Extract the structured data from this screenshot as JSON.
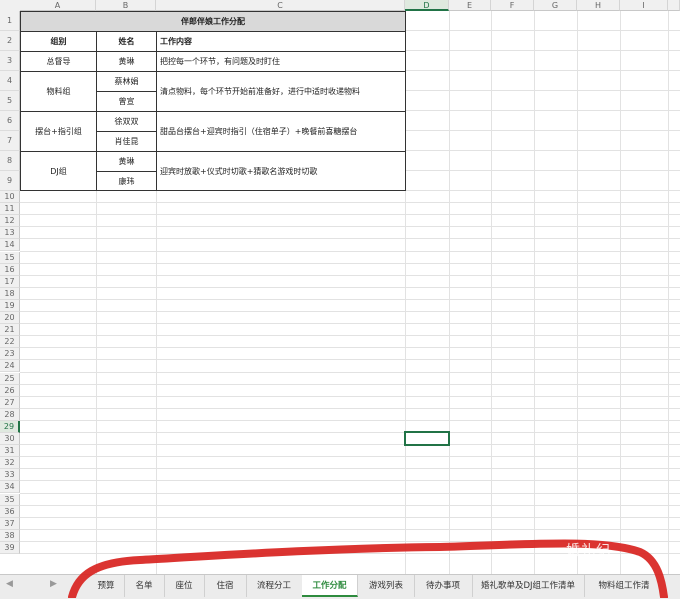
{
  "columns": [
    "A",
    "B",
    "C",
    "D",
    "E",
    "F",
    "G",
    "H",
    "I"
  ],
  "selected_column": "D",
  "rows": [
    "1",
    "2",
    "3",
    "4",
    "5",
    "6",
    "7",
    "8",
    "9",
    "10",
    "11",
    "12",
    "13",
    "14",
    "15",
    "16",
    "17",
    "18",
    "19",
    "20",
    "21",
    "22",
    "23",
    "24",
    "25",
    "26",
    "27",
    "28",
    "29",
    "30",
    "31",
    "32",
    "33",
    "34",
    "35",
    "36",
    "37",
    "38",
    "39"
  ],
  "selected_row": "29",
  "table": {
    "title": "伴郎伴娘工作分配",
    "headers": {
      "group": "组别",
      "name": "姓名",
      "content": "工作内容"
    },
    "groups": [
      {
        "group": "总督导",
        "names": [
          "黄琳"
        ],
        "content": "把控每一个环节，有问题及时盯住"
      },
      {
        "group": "物料组",
        "names": [
          "蔡林娟",
          "曾宣"
        ],
        "content": "清点物料，每个环节开始前准备好，进行中适时收递物料"
      },
      {
        "group": "摆台+指引组",
        "names": [
          "徐双双",
          "肖佳昆"
        ],
        "content": "甜品台摆台+迎宾时指引（住宿单子）+晚餐前喜糖摆台"
      },
      {
        "group": "DJ组",
        "names": [
          "黄琳",
          "康玮"
        ],
        "content": "迎宾时放歌+仪式时切歌+猜歌名游戏时切歌"
      }
    ]
  },
  "sheet_tabs": [
    "预算",
    "名单",
    "座位",
    "住宿",
    "流程分工",
    "工作分配",
    "游戏列表",
    "待办事项",
    "婚礼歌单及DJ组工作清单",
    "物料组工作清"
  ],
  "active_tab": "工作分配",
  "tab_nav": {
    "prev": "◀",
    "next": "▶"
  },
  "watermark": "婚礼纪",
  "colors": {
    "accent": "#217346",
    "tab_active": "#2e8b3e",
    "title_fill": "#d9d9d9",
    "annotation": "#d8231f"
  }
}
